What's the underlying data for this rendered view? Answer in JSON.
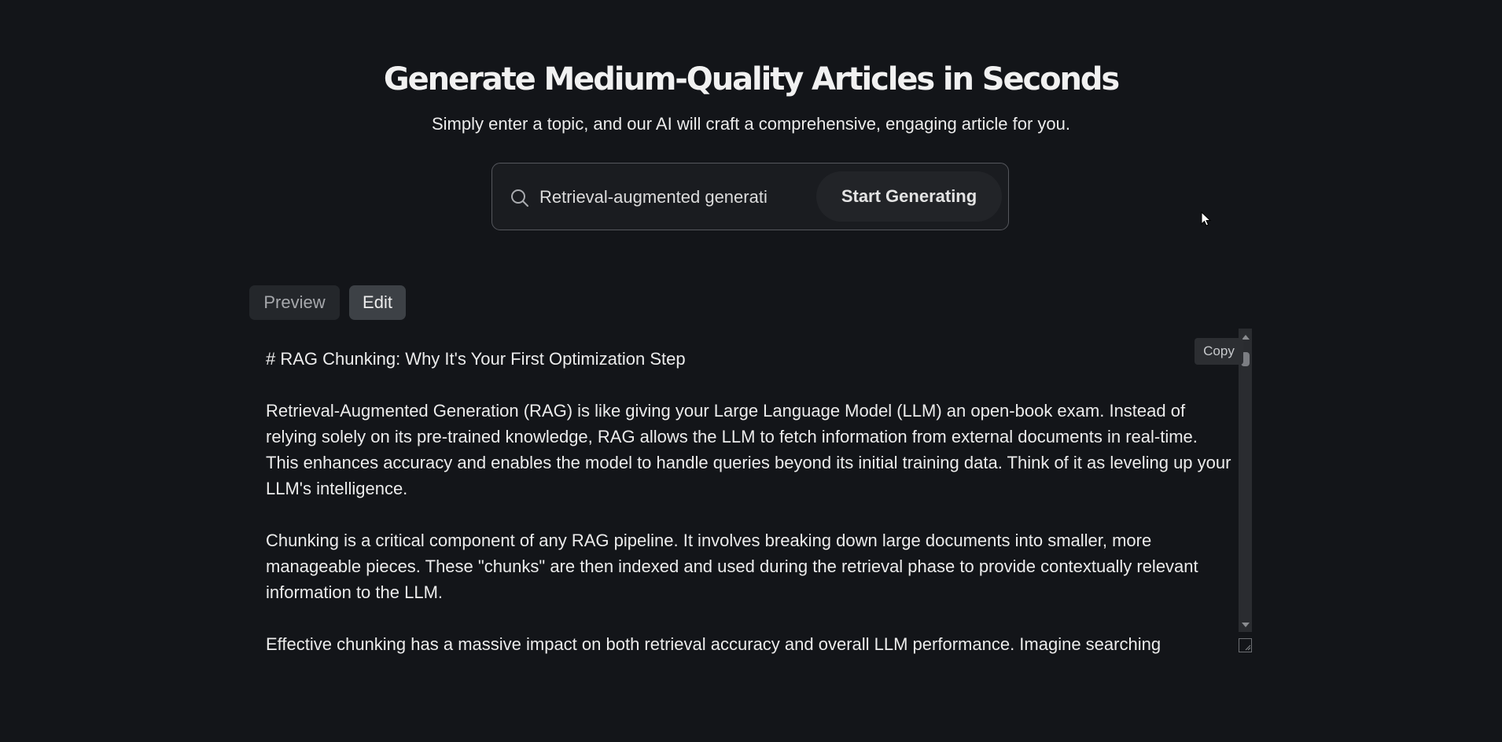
{
  "hero": {
    "title": "Generate Medium-Quality Articles in Seconds",
    "subtitle": "Simply enter a topic, and our AI will craft a comprehensive, engaging article for you."
  },
  "search": {
    "icon": "search-icon",
    "value": "Retrieval-augmented generation",
    "button_label": "Start Generating"
  },
  "tabs": [
    {
      "label": "Preview",
      "active": false
    },
    {
      "label": "Edit",
      "active": true
    }
  ],
  "editor": {
    "copy_label": "Copy",
    "heading": "# RAG Chunking: Why It's Your First Optimization Step",
    "paragraphs": [
      "Retrieval-Augmented Generation (RAG) is like giving your Large Language Model (LLM) an open-book exam. Instead of relying solely on its pre-trained knowledge, RAG allows the LLM to fetch information from external documents in real-time. This enhances accuracy and enables the model to handle queries beyond its initial training data. Think of it as leveling up your LLM's intelligence.",
      "Chunking is a critical component of any RAG pipeline. It involves breaking down large documents into smaller, more manageable pieces. These \"chunks\" are then indexed and used during the retrieval phase to provide contextually relevant information to the LLM.",
      "Effective chunking has a massive impact on both retrieval accuracy and overall LLM performance. Imagine searching"
    ]
  },
  "colors": {
    "background": "#131519",
    "accent_button": "#222428",
    "active_tab": "#3d4146"
  }
}
